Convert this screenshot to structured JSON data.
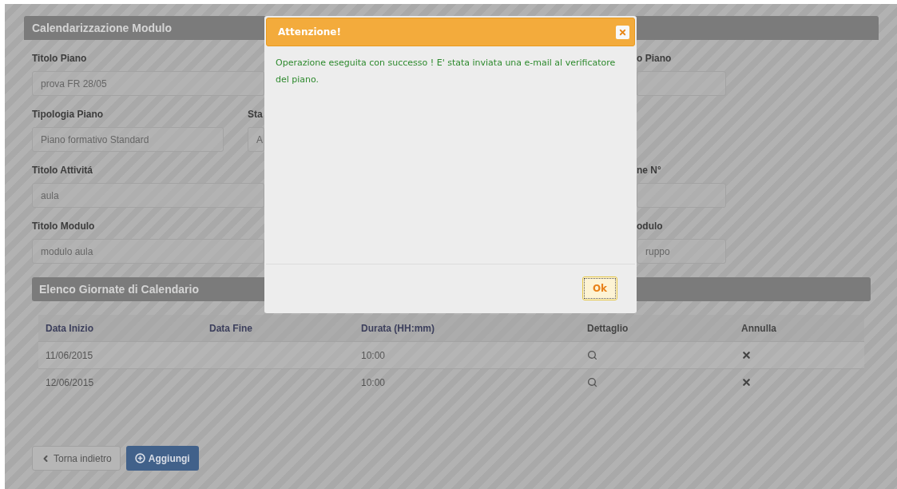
{
  "panel": {
    "title": "Calendarizzazione Modulo",
    "rows": [
      {
        "left": {
          "label": "Titolo Piano",
          "value": "prova FR 28/05"
        },
        "right": {
          "label": "o Piano"
        }
      },
      {
        "left": {
          "label": "Tipologia Piano",
          "value": "Piano formativo Standard"
        },
        "middle": {
          "label": "Sta",
          "value": "A"
        }
      },
      {
        "left": {
          "label": "Titolo Attivitá",
          "value": "aula"
        },
        "right": {
          "label": "ne N°"
        }
      },
      {
        "left": {
          "label": "Titolo Modulo",
          "value": "modulo aula"
        },
        "right": {
          "label": "odulo",
          "value": "ruppo"
        }
      }
    ]
  },
  "calendar": {
    "title": "Elenco Giornate di Calendario",
    "columns": [
      "Data Inizio",
      "Data Fine",
      "Durata (HH:mm)",
      "Dettaglio",
      "Annulla"
    ],
    "rows": [
      {
        "data_inizio": "11/06/2015",
        "durata": "10:00"
      },
      {
        "data_inizio": "12/06/2015",
        "durata": "10:00"
      }
    ]
  },
  "buttons": [
    {
      "kind": "back",
      "label": "Torna indietro"
    },
    {
      "kind": "add",
      "label": "Aggiungi"
    }
  ],
  "dialog": {
    "title": "Attenzione!",
    "message": "Operazione eseguita con successo ! E' stata inviata una e-mail al verificatore del piano.",
    "ok": "Ok"
  }
}
